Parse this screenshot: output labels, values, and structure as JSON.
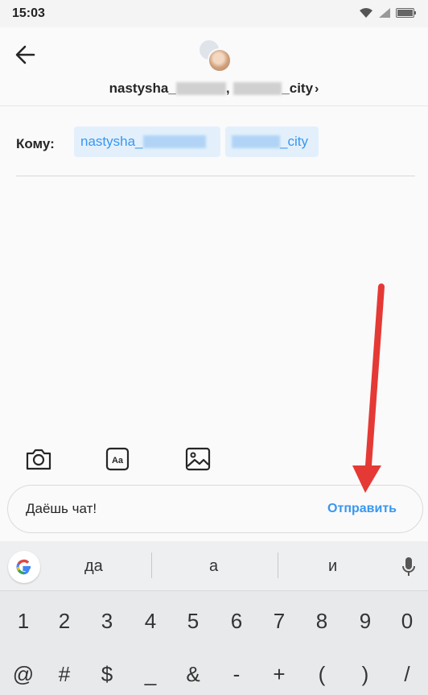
{
  "status": {
    "time": "15:03"
  },
  "header": {
    "title_part1": "nastysha_",
    "title_sep": ",",
    "title_part2": "_city",
    "chevron": "›"
  },
  "recipients": {
    "label": "Кому:",
    "chips": [
      "nastysha_",
      "_city"
    ]
  },
  "composer": {
    "message": "Даёшь чат!",
    "send_label": "Отправить"
  },
  "keyboard": {
    "suggestions": [
      "да",
      "а",
      "и"
    ],
    "digits": [
      "1",
      "2",
      "3",
      "4",
      "5",
      "6",
      "7",
      "8",
      "9",
      "0"
    ],
    "symbols": [
      "@",
      "#",
      "$",
      "_",
      "&",
      "-",
      "+",
      "(",
      ")",
      "/"
    ]
  },
  "colors": {
    "accent": "#3897f0",
    "arrow": "#e53935"
  }
}
